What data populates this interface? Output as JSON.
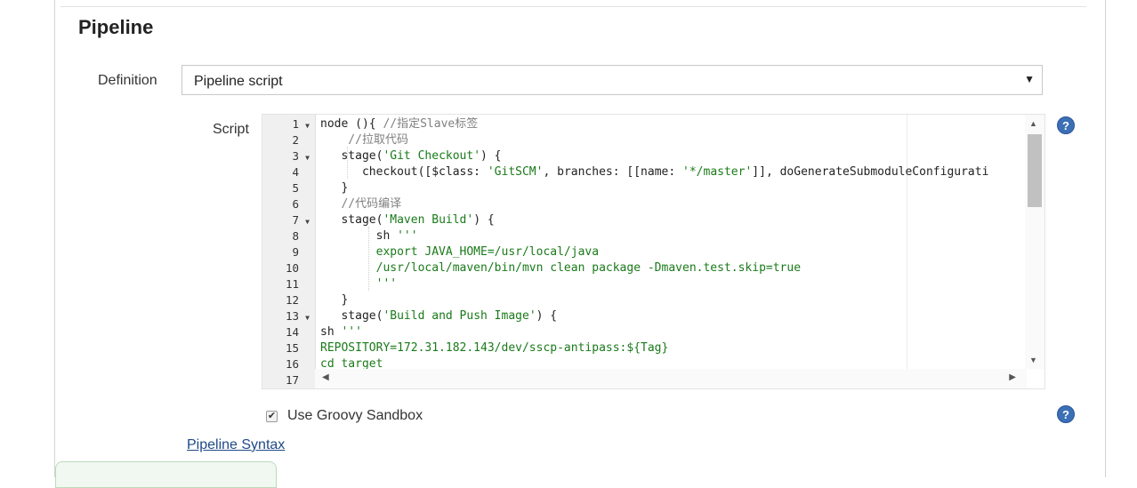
{
  "section": {
    "title": "Pipeline"
  },
  "definition": {
    "label": "Definition",
    "selected": "Pipeline script"
  },
  "script": {
    "label": "Script",
    "line_numbers": [
      "1",
      "2",
      "3",
      "4",
      "5",
      "6",
      "7",
      "8",
      "9",
      "10",
      "11",
      "12",
      "13",
      "14",
      "15",
      "16",
      "17"
    ],
    "fold_lines": [
      1,
      3,
      7,
      13
    ],
    "lines": [
      [
        {
          "t": "node (){ ",
          "k": "plain"
        },
        {
          "t": "//指定Slave标签",
          "k": "cmt"
        }
      ],
      [
        {
          "t": "    //拉取代码",
          "k": "cmt"
        }
      ],
      [
        {
          "t": "   stage(",
          "k": "plain"
        },
        {
          "t": "'Git Checkout'",
          "k": "str"
        },
        {
          "t": ") {",
          "k": "plain"
        }
      ],
      [
        {
          "t": "      checkout([$class: ",
          "k": "plain"
        },
        {
          "t": "'GitSCM'",
          "k": "str"
        },
        {
          "t": ", branches: [[name: ",
          "k": "plain"
        },
        {
          "t": "'*/master'",
          "k": "str"
        },
        {
          "t": "]], doGenerateSubmoduleConfigurati",
          "k": "plain"
        }
      ],
      [
        {
          "t": "   }",
          "k": "plain"
        }
      ],
      [
        {
          "t": "   //代码编译",
          "k": "cmt"
        }
      ],
      [
        {
          "t": "   stage(",
          "k": "plain"
        },
        {
          "t": "'Maven Build'",
          "k": "str"
        },
        {
          "t": ") {",
          "k": "plain"
        }
      ],
      [
        {
          "t": "        sh ",
          "k": "plain"
        },
        {
          "t": "'''",
          "k": "str"
        }
      ],
      [
        {
          "t": "        export JAVA_HOME=/usr/local/java",
          "k": "str"
        }
      ],
      [
        {
          "t": "        /usr/local/maven/bin/mvn clean package -Dmaven.test.skip=true",
          "k": "str"
        }
      ],
      [
        {
          "t": "        '''",
          "k": "str"
        }
      ],
      [
        {
          "t": "   }",
          "k": "plain"
        }
      ],
      [
        {
          "t": "   stage(",
          "k": "plain"
        },
        {
          "t": "'Build and Push Image'",
          "k": "str"
        },
        {
          "t": ") {",
          "k": "plain"
        }
      ],
      [
        {
          "t": "sh ",
          "k": "plain"
        },
        {
          "t": "'''",
          "k": "str"
        }
      ],
      [
        {
          "t": "REPOSITORY=172.31.182.143/dev/sscp-antipass:${Tag}",
          "k": "str"
        }
      ],
      [
        {
          "t": "cd target",
          "k": "str"
        }
      ],
      [
        {
          "t": "",
          "k": "plain"
        }
      ]
    ]
  },
  "help": {
    "icon": "help-icon",
    "glyph": "?",
    "color": "#3b6fb6"
  },
  "sandbox": {
    "label": "Use Groovy Sandbox",
    "checked": true,
    "check_glyph": "✔"
  },
  "links": {
    "pipeline_syntax": "Pipeline Syntax"
  },
  "icons": {
    "select_arrow": "▼",
    "scroll_up": "▲",
    "scroll_down": "▼",
    "scroll_left": "◀",
    "scroll_right": "▶"
  }
}
